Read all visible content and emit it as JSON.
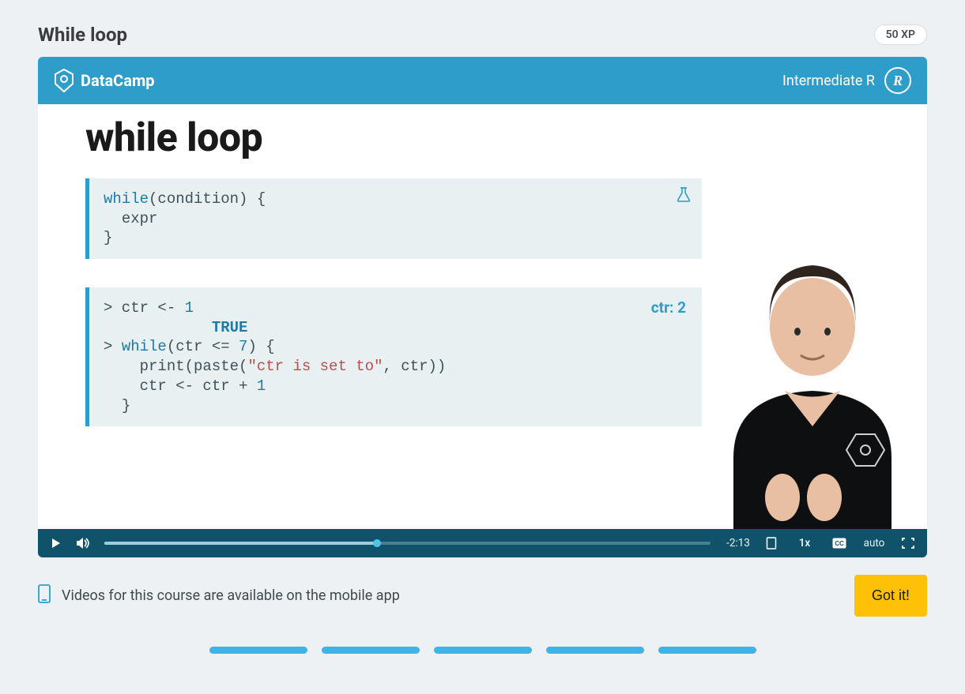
{
  "lesson": {
    "title": "While loop",
    "xp": "50 XP"
  },
  "video": {
    "brand": "DataCamp",
    "course": "Intermediate R",
    "slide_title": "while loop",
    "code1": {
      "l1_a": "while",
      "l1_b": "(condition) {",
      "l2": "expr",
      "l3": "}"
    },
    "code2": {
      "side": "ctr: 2",
      "l1_a": "> ctr <- ",
      "l1_b": "1",
      "l2": "TRUE",
      "l3_a": "> ",
      "l3_b": "while",
      "l3_c": "(ctr <= ",
      "l3_d": "7",
      "l3_e": ") {",
      "l4_a": "print(paste(",
      "l4_b": "\"ctr is set to\"",
      "l4_c": ", ctr))",
      "l5_a": "ctr <- ctr + ",
      "l5_b": "1",
      "l6": "}"
    },
    "remaining": "-2:13",
    "speed": "1x",
    "quality": "auto"
  },
  "notice": {
    "text": "Videos for this course are available on the mobile app",
    "button": "Got it!"
  }
}
